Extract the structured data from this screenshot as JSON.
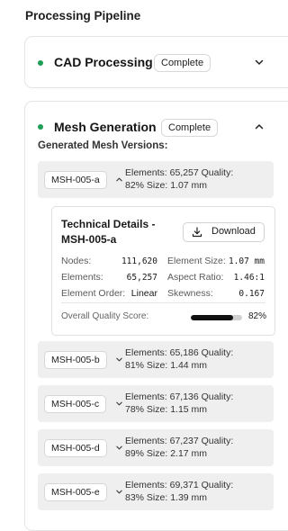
{
  "page_title": "Processing Pipeline",
  "colors": {
    "status_dot": "#1d9f55",
    "quality_bar": "#111111"
  },
  "stages": {
    "cad": {
      "title": "CAD Processing",
      "badge": "Complete",
      "expanded": false,
      "icon": "chevron-down-icon"
    },
    "mesh": {
      "title": "Mesh Generation",
      "badge": "Complete",
      "expanded": true,
      "icon": "chevron-up-icon"
    }
  },
  "mesh": {
    "versions_label": "Generated Mesh Versions:",
    "versions": [
      {
        "id": "MSH-005-a",
        "line1": "Elements: 65,257     Quality:",
        "line2": "82%     Size: 1.07 mm",
        "expanded": true
      },
      {
        "id": "MSH-005-b",
        "line1": "Elements: 65,186     Quality:",
        "line2": "81%     Size: 1.44 mm",
        "expanded": false
      },
      {
        "id": "MSH-005-c",
        "line1": "Elements: 67,136     Quality:",
        "line2": "78%     Size: 1.15 mm",
        "expanded": false
      },
      {
        "id": "MSH-005-d",
        "line1": "Elements: 67,237     Quality:",
        "line2": "89%     Size: 2.17 mm",
        "expanded": false
      },
      {
        "id": "MSH-005-e",
        "line1": "Elements: 69,371     Quality:",
        "line2": "83%     Size: 1.39 mm",
        "expanded": false
      }
    ],
    "details": {
      "title": "Technical Details - MSH-005-a",
      "download_label": "Download",
      "nodes_label": "Nodes:",
      "nodes": "111,620",
      "elements_label": "Elements:",
      "elements": "65,257",
      "order_label": "Element Order:",
      "order": "Linear",
      "size_label": "Element Size:",
      "size": "1.07 mm",
      "aspect_label": "Aspect Ratio:",
      "aspect": "1.46:1",
      "skew_label": "Skewness:",
      "skew": "0.167",
      "quality_label": "Overall Quality Score:",
      "quality_text": "82%",
      "quality_fraction": 0.82
    }
  }
}
